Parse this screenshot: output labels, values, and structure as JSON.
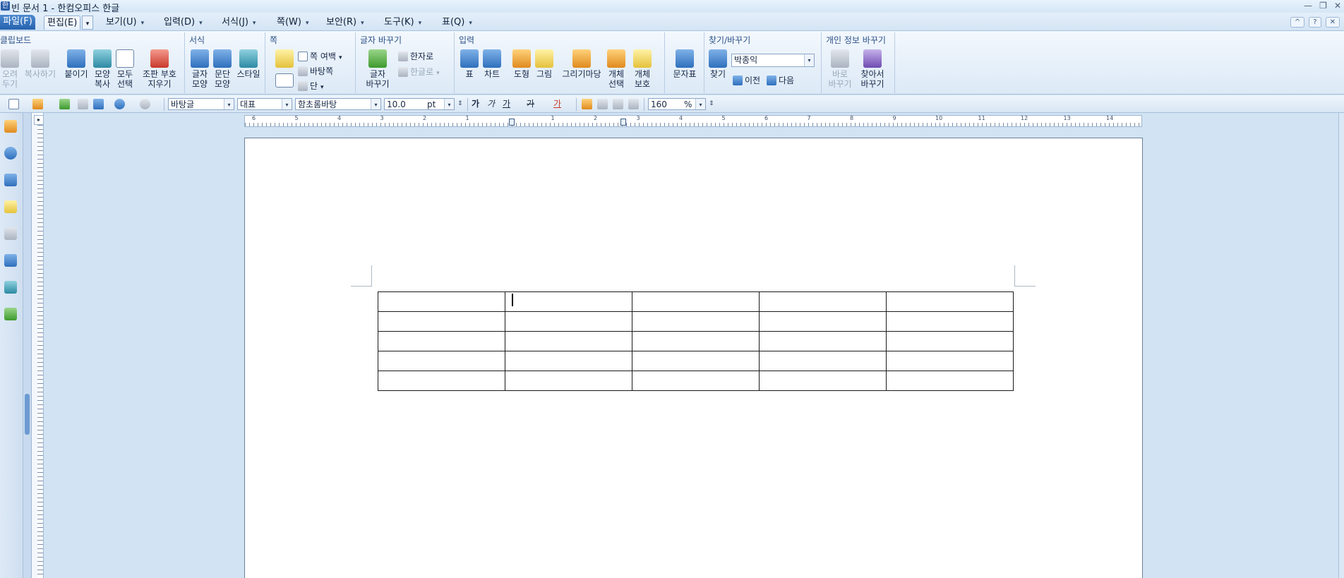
{
  "window": {
    "title": "빈 문서 1 - 한컴오피스 한글",
    "app_icon": "hwp-icon",
    "controls": [
      "—",
      "❐",
      "✕"
    ]
  },
  "menu": {
    "items": [
      {
        "label": "파일(F)"
      },
      {
        "label": "편집(E)"
      },
      {
        "label": "보기(U)"
      },
      {
        "label": "입력(D)"
      },
      {
        "label": "서식(J)"
      },
      {
        "label": "쪽(W)"
      },
      {
        "label": "보안(R)"
      },
      {
        "label": "도구(K)"
      },
      {
        "label": "표(Q)"
      }
    ],
    "arrow": "▾",
    "help": "?",
    "collapse": "^"
  },
  "ribbon": {
    "clipboard": {
      "title": "클립보드",
      "cut": "오려\n두기",
      "copy": "복사하기",
      "paste": "붙이기",
      "format_copy": "모양\n복사",
      "select_all": "모두\n선택",
      "clear_codes": "조판 부호\n지우기"
    },
    "format": {
      "title": "서식",
      "char_shape": "글자\n모양",
      "para_shape": "문단\n모양",
      "style": "스타일"
    },
    "page": {
      "title": "쪽",
      "margin": "쪽 여백",
      "background": "바탕쪽",
      "columns": "단"
    },
    "convert": {
      "title": "글자 바꾸기",
      "change_chars": "글자\n바꾸기",
      "to_hanja": "한자로",
      "to_hangul": "한글로"
    },
    "insert": {
      "title": "입력",
      "table": "표",
      "chart": "차트",
      "shape": "도형",
      "picture": "그림",
      "drawing_madang": "그리기마당",
      "select_object": "개체\n선택",
      "protect_object": "개체\n보호"
    },
    "char_map": {
      "label": "문자표"
    },
    "find": {
      "title": "찾기/바꾸기",
      "find": "찾기",
      "query": "박종익",
      "prev": "이전",
      "next": "다음"
    },
    "privacy": {
      "title": "개인 정보 바꾸기",
      "change_now": "바로\n바꾸기",
      "find_change": "찾아서\n바꾸기"
    }
  },
  "toolbar": {
    "style": "바탕글",
    "lang": "대표",
    "font": "함초롬바탕",
    "size": "10.0",
    "unit": "pt",
    "bold": "가",
    "italic": "가",
    "underline": "가",
    "strike": "가",
    "color": "가",
    "zoom": "160",
    "zoom_unit": "%"
  },
  "ruler": {
    "numbers": [
      "6",
      "5",
      "4",
      "3",
      "2",
      "1",
      "",
      "1",
      "2",
      "3",
      "4",
      "5",
      "6",
      "7",
      "8",
      "9",
      "10",
      "11",
      "12",
      "13",
      "14"
    ]
  },
  "document": {
    "table": {
      "rows": 5,
      "cols": 5
    }
  }
}
